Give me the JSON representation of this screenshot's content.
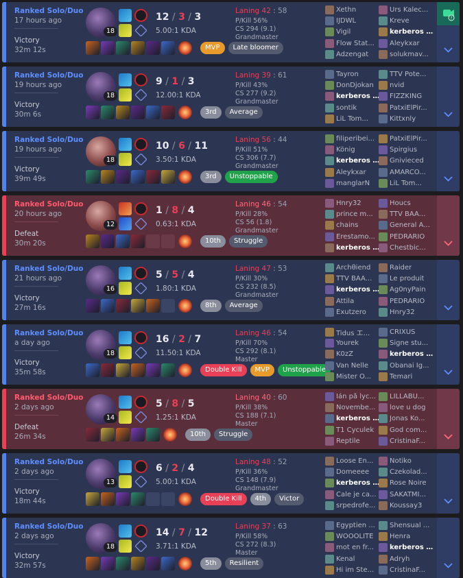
{
  "matches": [
    {
      "result": "win",
      "queue": "Ranked Solo/Duo",
      "ago": "17 hours ago",
      "outcome": "Victory",
      "duration": "32m 12s",
      "level": "18",
      "kills": "12",
      "deaths": "3",
      "assists": "3",
      "ratio": "5.00:1 KDA",
      "laning_w": "Laning 42",
      "laning_r": "58",
      "pkill": "P/Kill 56%",
      "cs": "CS 294 (9.1)",
      "tier": "Grandmaster",
      "items": 6,
      "empty": 0,
      "tags": [
        {
          "t": "MVP",
          "c": "t-mvp"
        },
        {
          "t": "Late bloomer",
          "c": "t-grey"
        }
      ],
      "team1": [
        "Xethn",
        "IJDWL",
        "Vigil",
        "Flow Stat...",
        "Adzengat"
      ],
      "team2": [
        "Urs Kalec...",
        "Kreve",
        "kerberos ...",
        "Aleykxar",
        "solukmav..."
      ],
      "me": "t2-2",
      "video": true
    },
    {
      "result": "win",
      "queue": "Ranked Solo/Duo",
      "ago": "19 hours ago",
      "outcome": "Victory",
      "duration": "30m 6s",
      "level": "18",
      "kills": "9",
      "deaths": "1",
      "assists": "3",
      "ratio": "12.00:1 KDA",
      "laning_w": "Laning 39",
      "laning_r": "61",
      "pkill": "P/Kill 43%",
      "cs": "CS 277 (9.2)",
      "tier": "Grandmaster",
      "items": 6,
      "empty": 0,
      "tags": [
        {
          "t": "3rd",
          "c": "t-rank"
        },
        {
          "t": "Average",
          "c": "t-grey"
        }
      ],
      "team1": [
        "Tayron",
        "DonDjokan",
        "kerberos ...",
        "sontik",
        "LiL Tom..."
      ],
      "team2": [
        "TTV Pote...",
        "nvid",
        "FIZZKING",
        "PatxiElPir...",
        "Kittxnly"
      ],
      "me": "t1-2"
    },
    {
      "result": "win",
      "queue": "Ranked Solo/Duo",
      "ago": "19 hours ago",
      "outcome": "Victory",
      "duration": "39m 49s",
      "level": "18",
      "kills": "10",
      "deaths": "6",
      "assists": "11",
      "ratio": "3.50:1 KDA",
      "laning_w": "Laning 56",
      "laning_r": "44",
      "pkill": "P/Kill 51%",
      "cs": "CS 306 (7.7)",
      "tier": "Grandmaster",
      "items": 6,
      "empty": 0,
      "alt": true,
      "tags": [
        {
          "t": "3rd",
          "c": "t-rank"
        },
        {
          "t": "Unstoppable",
          "c": "t-green"
        }
      ],
      "team1": [
        "filiperibei...",
        "König",
        "kerberos ...",
        "Aleykxar",
        "manglarN"
      ],
      "team2": [
        "PatxiElPir...",
        "Spirgius",
        "Gnivieced",
        "AMARCO...",
        "LiL Tom..."
      ],
      "me": "t1-2"
    },
    {
      "result": "loss",
      "queue": "Ranked Solo/Duo",
      "ago": "20 hours ago",
      "outcome": "Defeat",
      "duration": "30m 20s",
      "level": "12",
      "kills": "1",
      "deaths": "8",
      "assists": "4",
      "ratio": "0.63:1 KDA",
      "laning_w": "Laning 46",
      "laning_r": "54",
      "pkill": "P/Kill 28%",
      "cs": "CS 56 (1.8)",
      "tier": "Grandmaster",
      "items": 4,
      "empty": 2,
      "alt": true,
      "red": true,
      "tags": [
        {
          "t": "10th",
          "c": "t-rank"
        },
        {
          "t": "Struggle",
          "c": "t-grey"
        }
      ],
      "team1": [
        "Hnry32",
        "prince m...",
        "chains",
        "Erestamo...",
        "kerberos ..."
      ],
      "team2": [
        "Houcs",
        "TTV BAA...",
        "General A...",
        "PEDRARIO",
        "Chestbic..."
      ],
      "me": "t1-4"
    },
    {
      "result": "win",
      "queue": "Ranked Solo/Duo",
      "ago": "21 hours ago",
      "outcome": "Victory",
      "duration": "27m 16s",
      "level": "16",
      "kills": "5",
      "deaths": "5",
      "assists": "4",
      "ratio": "1.80:1 KDA",
      "laning_w": "Laning 47",
      "laning_r": "53",
      "pkill": "P/Kill 30%",
      "cs": "CS 232 (8.5)",
      "tier": "Grandmaster",
      "items": 5,
      "empty": 1,
      "tags": [
        {
          "t": "8th",
          "c": "t-rank"
        },
        {
          "t": "Average",
          "c": "t-grey"
        }
      ],
      "team1": [
        "Archθiend",
        "TTV BAA...",
        "kerberos ...",
        "Attila",
        "Exutzero"
      ],
      "team2": [
        "Raider",
        "Le produit",
        "Ag0nyPain",
        "PEDRARIO",
        "Hnry32"
      ],
      "me": "t1-2"
    },
    {
      "result": "win",
      "queue": "Ranked Solo/Duo",
      "ago": "a day ago",
      "outcome": "Victory",
      "duration": "35m 58s",
      "level": "18",
      "kills": "16",
      "deaths": "2",
      "assists": "7",
      "ratio": "11.50:1 KDA",
      "laning_w": "Laning 46",
      "laning_r": "54",
      "pkill": "P/Kill 70%",
      "cs": "CS 292 (8.1)",
      "tier": "Master",
      "items": 6,
      "empty": 0,
      "tags": [
        {
          "t": "Double Kill",
          "c": "t-red"
        },
        {
          "t": "MVP",
          "c": "t-mvp"
        },
        {
          "t": "Unstoppable",
          "c": "t-green"
        }
      ],
      "team1": [
        "Tidus エ...",
        "Yourek",
        "K0zZ",
        "Van Nelle",
        "Mister O..."
      ],
      "team2": [
        "CRIXUS",
        "Signe stu...",
        "kerberos ...",
        "Obanai Ig...",
        "Temari"
      ],
      "me": "t2-2"
    },
    {
      "result": "loss",
      "queue": "Ranked Solo/Duo",
      "ago": "2 days ago",
      "outcome": "Defeat",
      "duration": "26m 34s",
      "level": "14",
      "kills": "5",
      "deaths": "8",
      "assists": "5",
      "ratio": "1.25:1 KDA",
      "laning_w": "Laning 40",
      "laning_r": "60",
      "pkill": "P/Kill 38%",
      "cs": "CS 188 (7.1)",
      "tier": "Master",
      "items": 5,
      "empty": 0,
      "tags": [
        {
          "t": "10th",
          "c": "t-rank"
        },
        {
          "t": "Struggle",
          "c": "t-grey"
        }
      ],
      "team1": [
        "Ián på lyc...",
        "Novembe...",
        "kerberos ...",
        "T1 Cyculek",
        "Reptile"
      ],
      "team2": [
        "LILLABU...",
        "love u dog",
        "Jonas Ko...",
        "God com...",
        "CristinaF..."
      ],
      "me": "t1-2"
    },
    {
      "result": "win",
      "queue": "Ranked Solo/Duo",
      "ago": "2 days ago",
      "outcome": "Victory",
      "duration": "18m 44s",
      "level": "13",
      "kills": "6",
      "deaths": "2",
      "assists": "4",
      "ratio": "5.00:1 KDA",
      "laning_w": "Laning 48",
      "laning_r": "52",
      "pkill": "P/Kill 36%",
      "cs": "CS 148 (7.9)",
      "tier": "Grandmaster",
      "items": 4,
      "empty": 2,
      "tags": [
        {
          "t": "Double Kill",
          "c": "t-red"
        },
        {
          "t": "4th",
          "c": "t-rank"
        },
        {
          "t": "Victor",
          "c": "t-grey"
        }
      ],
      "team1": [
        "Loose En...",
        "Domeeee",
        "kerberos ...",
        "Cale je ca...",
        "srpedrofe..."
      ],
      "team2": [
        "Notiko",
        "Czekolad...",
        "Rose Noire",
        "SAKATMİ...",
        "Koussay3"
      ],
      "me": "t1-2"
    },
    {
      "result": "win",
      "queue": "Ranked Solo/Duo",
      "ago": "2 days ago",
      "outcome": "Victory",
      "duration": "32m 57s",
      "level": "18",
      "kills": "14",
      "deaths": "7",
      "assists": "12",
      "ratio": "3.71:1 KDA",
      "laning_w": "Laning 37",
      "laning_r": "63",
      "pkill": "P/Kill 58%",
      "cs": "CS 272 (8.3)",
      "tier": "Master",
      "items": 6,
      "empty": 0,
      "tags": [
        {
          "t": "5th",
          "c": "t-rank"
        },
        {
          "t": "Resilient",
          "c": "t-grey"
        }
      ],
      "team1": [
        "Egyptien ...",
        "WOOOLITE",
        "mot en fr...",
        "Kenal",
        "Hi im Ste..."
      ],
      "team2": [
        "Shensual ...",
        "Henra",
        "kerberos ...",
        "Adryh",
        "CristinaF..."
      ],
      "me": "t2-2"
    }
  ],
  "icons": {
    "expand": "chevron-down-icon",
    "video": "video-icon"
  }
}
